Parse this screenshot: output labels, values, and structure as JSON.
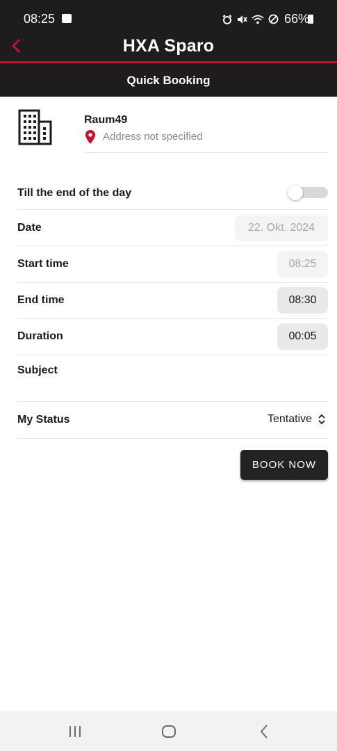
{
  "status_bar": {
    "time": "08:25",
    "battery": "66%"
  },
  "header": {
    "title": "HXA Sparo",
    "subtitle": "Quick Booking"
  },
  "location": {
    "room": "Raum49",
    "address": "Address not specified"
  },
  "form": {
    "till_end_label": "Till the end of the day",
    "till_end_value": false,
    "date_label": "Date",
    "date_value": "22. Okt. 2024",
    "start_label": "Start time",
    "start_value": "08:25",
    "end_label": "End time",
    "end_value": "08:30",
    "duration_label": "Duration",
    "duration_value": "00:05",
    "subject_label": "Subject",
    "status_label": "My Status",
    "status_value": "Tentative"
  },
  "actions": {
    "book_now": "BOOK NOW"
  },
  "colors": {
    "header_bg": "#1e1c1d",
    "accent_red": "#c8102e",
    "button_bg": "#232323"
  }
}
